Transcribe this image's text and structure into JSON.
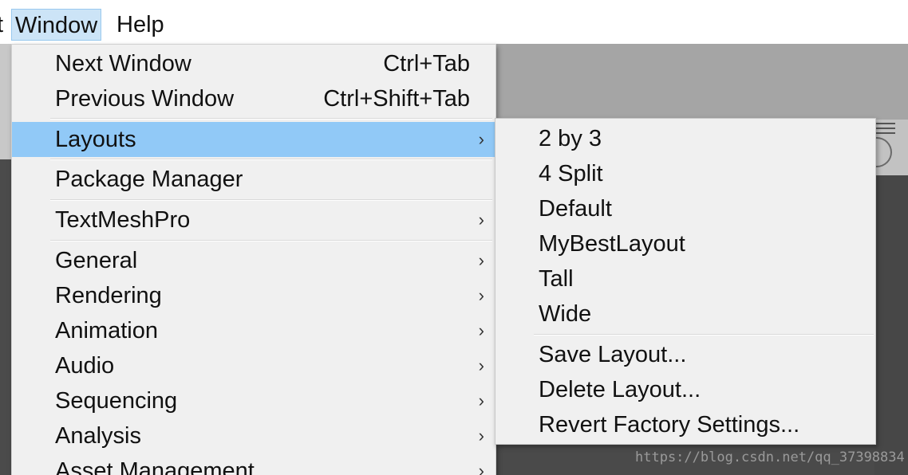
{
  "menubar": {
    "items": [
      {
        "label": "t"
      },
      {
        "label": "Window"
      },
      {
        "label": "Help"
      }
    ]
  },
  "window_menu": {
    "next_window": {
      "label": "Next Window",
      "shortcut": "Ctrl+Tab"
    },
    "previous_window": {
      "label": "Previous Window",
      "shortcut": "Ctrl+Shift+Tab"
    },
    "layouts": {
      "label": "Layouts"
    },
    "package_manager": {
      "label": "Package Manager"
    },
    "textmeshpro": {
      "label": "TextMeshPro"
    },
    "general": {
      "label": "General"
    },
    "rendering": {
      "label": "Rendering"
    },
    "animation": {
      "label": "Animation"
    },
    "audio": {
      "label": "Audio"
    },
    "sequencing": {
      "label": "Sequencing"
    },
    "analysis": {
      "label": "Analysis"
    },
    "asset_management": {
      "label": "Asset Management"
    },
    "submenu_arrow": "›"
  },
  "layouts_submenu": {
    "items": [
      {
        "label": "2 by 3"
      },
      {
        "label": "4 Split"
      },
      {
        "label": "Default"
      },
      {
        "label": "MyBestLayout"
      },
      {
        "label": "Tall"
      },
      {
        "label": "Wide"
      }
    ],
    "save_layout": "Save Layout...",
    "delete_layout": "Delete Layout...",
    "revert_factory": "Revert Factory Settings..."
  },
  "watermark": "https://blog.csdn.net/qq_37398834",
  "colors": {
    "highlight": "#91c9f7",
    "menu_bg": "#f0f0f0",
    "menubar_active": "#cce4f7"
  }
}
